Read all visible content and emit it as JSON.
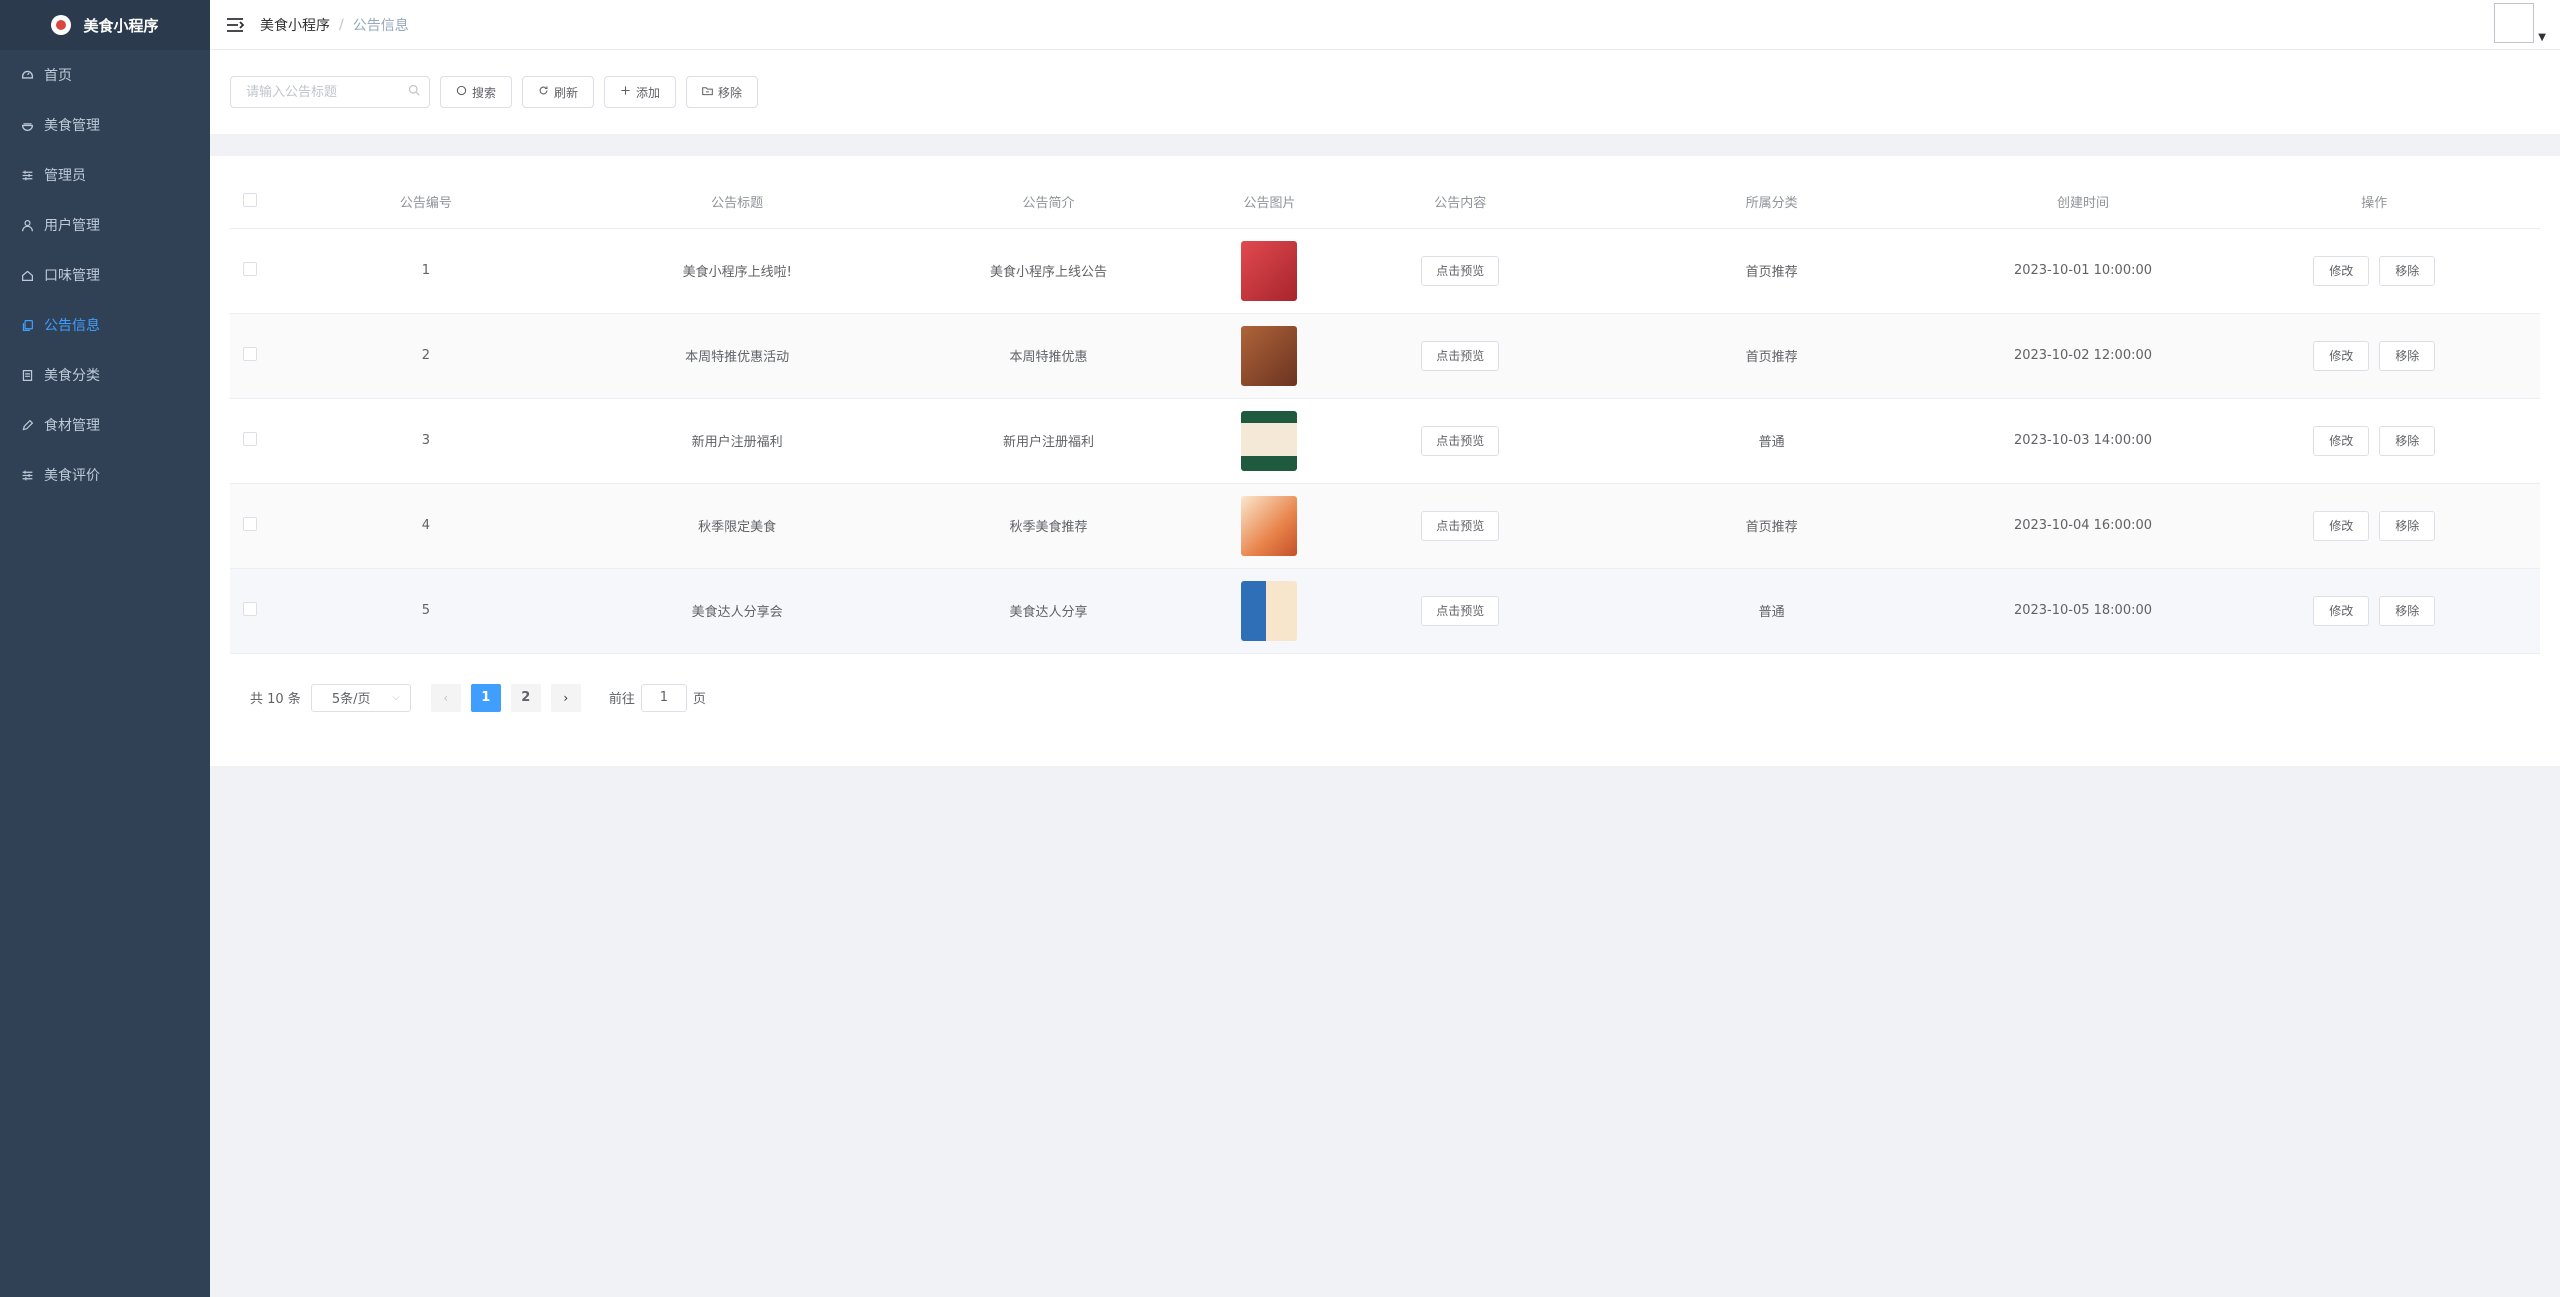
{
  "app": {
    "title": "美食小程序"
  },
  "sidebar": {
    "items": [
      {
        "label": "首页",
        "icon": "dashboard-icon"
      },
      {
        "label": "美食管理",
        "icon": "food-icon"
      },
      {
        "label": "管理员",
        "icon": "sliders-icon"
      },
      {
        "label": "用户管理",
        "icon": "user-icon"
      },
      {
        "label": "口味管理",
        "icon": "home-icon"
      },
      {
        "label": "公告信息",
        "icon": "copy-icon",
        "active": true
      },
      {
        "label": "美食分类",
        "icon": "list-icon"
      },
      {
        "label": "食材管理",
        "icon": "edit-icon"
      },
      {
        "label": "美食评价",
        "icon": "sliders-icon"
      }
    ]
  },
  "breadcrumb": {
    "home": "美食小程序",
    "separator": "/",
    "current": "公告信息"
  },
  "toolbar": {
    "search_placeholder": "请输入公告标题",
    "search_label": "搜索",
    "refresh_label": "刷新",
    "add_label": "添加",
    "remove_label": "移除"
  },
  "table": {
    "headers": [
      "公告编号",
      "公告标题",
      "公告简介",
      "公告图片",
      "公告内容",
      "所属分类",
      "创建时间",
      "操作"
    ],
    "preview_label": "点击预览",
    "edit_label": "修改",
    "delete_label": "移除",
    "rows": [
      {
        "id": "1",
        "title": "美食小程序上线啦!",
        "summary": "美食小程序上线公告",
        "category": "首页推荐",
        "created": "2023-10-01 10:00:00",
        "image_color": "#c7333a"
      },
      {
        "id": "2",
        "title": "本周特推优惠活动",
        "summary": "本周特推优惠",
        "category": "首页推荐",
        "created": "2023-10-02 12:00:00",
        "image_color": "#8a4a2a"
      },
      {
        "id": "3",
        "title": "新用户注册福利",
        "summary": "新用户注册福利",
        "category": "普通",
        "created": "2023-10-03 14:00:00",
        "image_color": "#1f5a3f"
      },
      {
        "id": "4",
        "title": "秋季限定美食",
        "summary": "秋季美食推荐",
        "category": "首页推荐",
        "created": "2023-10-04 16:00:00",
        "image_color": "#e8834a"
      },
      {
        "id": "5",
        "title": "美食达人分享会",
        "summary": "美食达人分享",
        "category": "普通",
        "created": "2023-10-05 18:00:00",
        "image_color": "#2f6fb8"
      }
    ]
  },
  "pagination": {
    "total_label": "共 10 条",
    "page_size": "5条/页",
    "pages": [
      "1",
      "2"
    ],
    "current_page": "1",
    "goto_label": "前往",
    "goto_value": "1",
    "page_suffix": "页"
  },
  "colors": {
    "sidebar_bg": "#304156",
    "accent": "#409eff"
  }
}
